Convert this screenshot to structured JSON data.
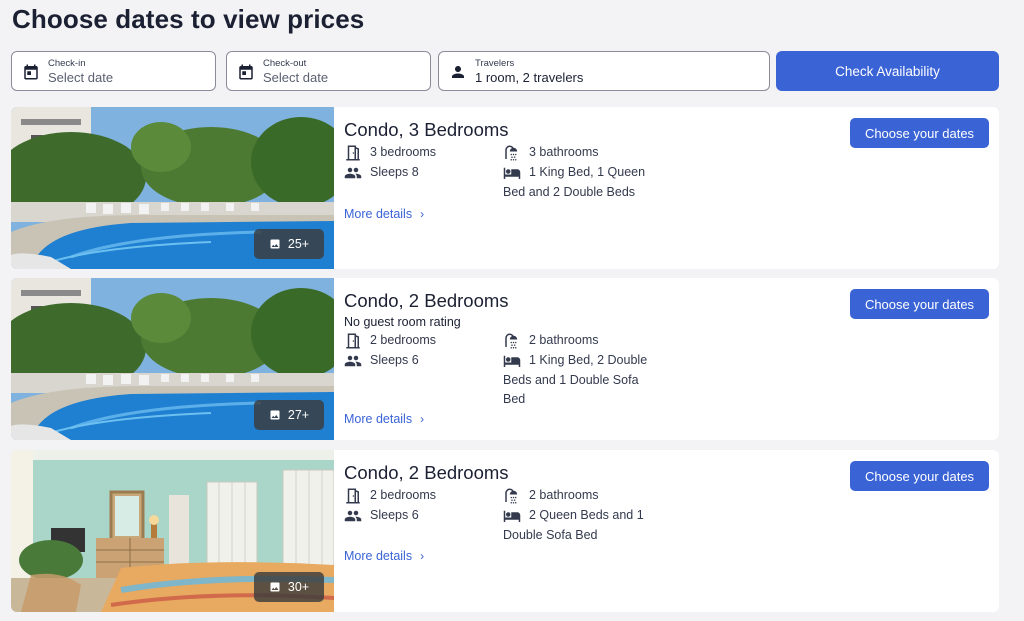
{
  "page": {
    "title": "Choose dates to view prices"
  },
  "search": {
    "checkin": {
      "label": "Check-in",
      "value": "Select date",
      "icon": "calendar-icon"
    },
    "checkout": {
      "label": "Check-out",
      "value": "Select date",
      "icon": "calendar-icon"
    },
    "travelers": {
      "label": "Travelers",
      "value": "1 room, 2 travelers",
      "icon": "person-icon"
    },
    "check_availability_label": "Check Availability"
  },
  "colors": {
    "accent": "#3a63d6",
    "text": "#1b2033",
    "background": "#f3f3f5"
  },
  "rooms": [
    {
      "name": "Condo, 3 Bedrooms",
      "rating": "",
      "bedrooms": "3 bedrooms",
      "sleeps": "Sleeps 8",
      "bathrooms": "3 bathrooms",
      "beds": "1 King Bed, 1 Queen Bed and 2 Double Beds",
      "more_details": "More details",
      "choose_label": "Choose your dates",
      "photo_count": "25+",
      "photo": "pool"
    },
    {
      "name": "Condo, 2 Bedrooms",
      "rating": "No guest room rating",
      "bedrooms": "2 bedrooms",
      "sleeps": "Sleeps 6",
      "bathrooms": "2 bathrooms",
      "beds": "1 King Bed, 2 Double Beds and 1 Double Sofa Bed",
      "more_details": "More details",
      "choose_label": "Choose your dates",
      "photo_count": "27+",
      "photo": "pool"
    },
    {
      "name": "Condo, 2 Bedrooms",
      "rating": "",
      "bedrooms": "2 bedrooms",
      "sleeps": "Sleeps 6",
      "bathrooms": "2 bathrooms",
      "beds": "2 Queen Beds and 1 Double Sofa Bed",
      "more_details": "More details",
      "choose_label": "Choose your dates",
      "photo_count": "30+",
      "photo": "bedroom"
    }
  ]
}
